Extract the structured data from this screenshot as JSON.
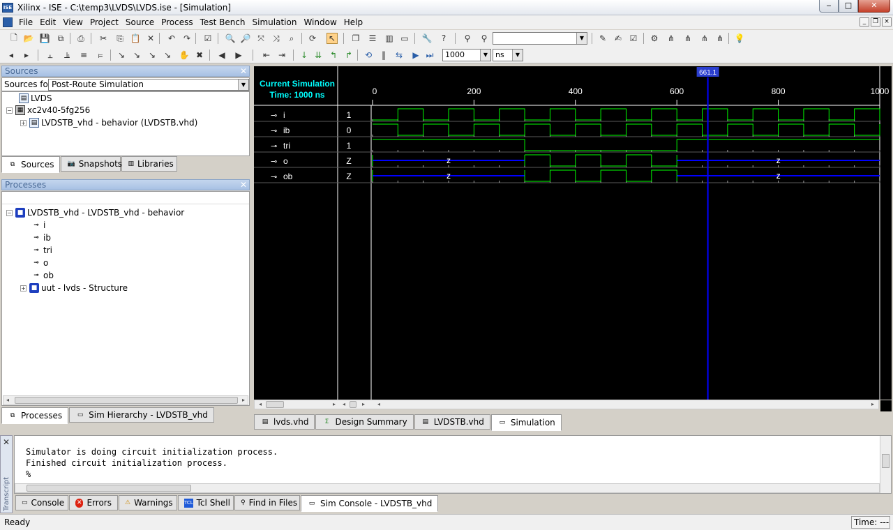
{
  "window": {
    "title": "Xilinx - ISE - C:\\temp3\\LVDS\\LVDS.ise - [Simulation]",
    "app_icon_text": "ISE"
  },
  "menu": [
    "File",
    "Edit",
    "View",
    "Project",
    "Source",
    "Process",
    "Test Bench",
    "Simulation",
    "Window",
    "Help"
  ],
  "toolbar": {
    "time_value": "1000",
    "time_unit": "ns"
  },
  "sources_panel": {
    "title": "Sources",
    "sources_for_label": "Sources for:",
    "sources_for_value": "Post-Route Simulation",
    "tree": [
      "LVDS",
      "xc2v40-5fg256",
      "LVDSTB_vhd - behavior (LVDSTB.vhd)"
    ],
    "tabs": [
      "Sources",
      "Snapshots",
      "Libraries"
    ]
  },
  "processes_panel": {
    "title": "Processes",
    "root": "LVDSTB_vhd - LVDSTB_vhd - behavior",
    "signals": [
      "i",
      "ib",
      "tri",
      "o",
      "ob"
    ],
    "sub": "uut - lvds - Structure",
    "tabs": [
      "Processes",
      "Sim Hierarchy - LVDSTB_vhd"
    ]
  },
  "waveform": {
    "header_line1": "Current Simulation",
    "header_line2": "Time: 1000 ns",
    "cursor_label": "661.1",
    "cursor_time_ns": 661.1,
    "scale_ticks": [
      0,
      200,
      400,
      600,
      800,
      1000
    ],
    "signals": [
      {
        "name": "i",
        "value": "1"
      },
      {
        "name": "ib",
        "value": "0"
      },
      {
        "name": "tri",
        "value": "1"
      },
      {
        "name": "o",
        "value": "Z"
      },
      {
        "name": "ob",
        "value": "Z"
      }
    ],
    "z_label": "Z",
    "colors": {
      "wave": "#00ff00",
      "hiz": "#0000ff",
      "cursor": "#0000ff",
      "text": "#ffffff",
      "header": "#00ffff"
    }
  },
  "editor_tabs": [
    "lvds.vhd",
    "Design Summary",
    "LVDSTB.vhd",
    "Simulation"
  ],
  "console": {
    "side_label": "Transcript",
    "lines": [
      "Simulator is doing circuit initialization process.",
      "Finished circuit initialization process.",
      "%"
    ],
    "tabs": [
      "Console",
      "Errors",
      "Warnings",
      "Tcl Shell",
      "Find in Files",
      "Sim Console - LVDSTB_vhd"
    ]
  },
  "status": {
    "left": "Ready",
    "right": "Time: ---"
  }
}
